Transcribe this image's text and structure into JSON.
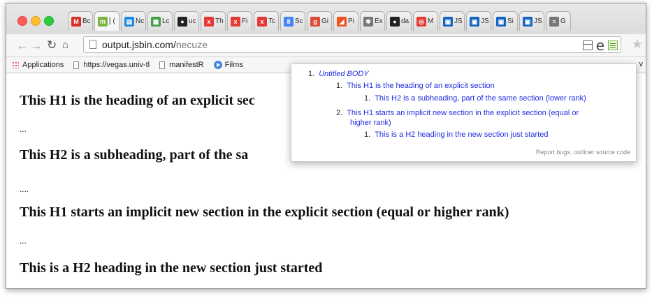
{
  "tabs": [
    {
      "label": "Bc",
      "icon": "gmail-icon",
      "color": "#d93025",
      "glyph": "M",
      "active": false
    },
    {
      "label": "[ (",
      "icon": "m-icon",
      "color": "#7cb342",
      "glyph": "m",
      "active": true
    },
    {
      "label": "Nc",
      "icon": "doc-icon",
      "color": "#1e88e5",
      "glyph": "▤",
      "active": false
    },
    {
      "label": "Lc",
      "icon": "sheet-icon",
      "color": "#43a047",
      "glyph": "▦",
      "active": false
    },
    {
      "label": "uc",
      "icon": "github-icon",
      "color": "#222222",
      "glyph": "●",
      "active": false
    },
    {
      "label": "Th",
      "icon": "xsl-icon",
      "color": "#e53935",
      "glyph": "x",
      "active": false
    },
    {
      "label": "Fi",
      "icon": "xsl-icon",
      "color": "#e53935",
      "glyph": "x",
      "active": false
    },
    {
      "label": "Tc",
      "icon": "xsl-icon",
      "color": "#e53935",
      "glyph": "x",
      "active": false
    },
    {
      "label": "Sc",
      "icon": "google-search-icon",
      "color": "#4285f4",
      "glyph": "8",
      "active": false
    },
    {
      "label": "Gi",
      "icon": "google-plus-icon",
      "color": "#dd4b39",
      "glyph": "g",
      "active": false
    },
    {
      "label": "Pi",
      "icon": "slope-icon",
      "color": "#f4511e",
      "glyph": "◢",
      "active": false
    },
    {
      "label": "Ex",
      "icon": "puzzle-icon",
      "color": "#777777",
      "glyph": "✱",
      "active": false
    },
    {
      "label": "da",
      "icon": "github-icon",
      "color": "#222222",
      "glyph": "●",
      "active": false
    },
    {
      "label": "M",
      "icon": "target-icon",
      "color": "#e53935",
      "glyph": "◎",
      "active": false
    },
    {
      "label": "JS",
      "icon": "js-icon",
      "color": "#1565c0",
      "glyph": "▣",
      "active": false
    },
    {
      "label": "JS",
      "icon": "js-icon",
      "color": "#1565c0",
      "glyph": "▣",
      "active": false
    },
    {
      "label": "Si",
      "icon": "js-icon",
      "color": "#1565c0",
      "glyph": "▣",
      "active": false
    },
    {
      "label": "JS",
      "icon": "js-icon",
      "color": "#1565c0",
      "glyph": "▣",
      "active": false
    },
    {
      "label": "G",
      "icon": "list-icon",
      "color": "#777777",
      "glyph": "≡",
      "active": false
    }
  ],
  "toolbar": {
    "url_host": "output.jsbin.com/",
    "url_path": "necuze"
  },
  "bookmarks": [
    {
      "label": "Applications",
      "icon": "apps-grid-icon"
    },
    {
      "label": "https://vegas.univ-tl",
      "icon": "page-icon"
    },
    {
      "label": "manifestR",
      "icon": "page-icon"
    },
    {
      "label": "Films",
      "icon": "play-circle-icon"
    }
  ],
  "bookmarks_trailing": "v",
  "content": {
    "h1_first": "This H1 is the heading of an explicit sec",
    "p1": "...",
    "h2_first": "This H2 is a subheading, part of the sa",
    "h2_first_trail": "(",
    "p2": "....",
    "h1_second": "This H1 starts an implicit new section in the explicit section (equal or higher rank)",
    "p3": "...",
    "h2_second": "This is a H2 heading in the new section just started"
  },
  "outline": {
    "items": [
      {
        "num": "1.",
        "text": "Untitled BODY"
      },
      {
        "num": "1.",
        "text": "This H1 is the heading of an explicit section"
      },
      {
        "num": "1.",
        "text": "This H2 is a subheading, part of the same section (lower rank)"
      },
      {
        "num": "2.",
        "text": "This H1 starts an implicit new section in the explicit section (equal or"
      },
      {
        "num": "",
        "text": "higher rank)"
      },
      {
        "num": "1.",
        "text": "This is a H2 heading in the new section just started"
      }
    ],
    "footer_link1": "Report bugs",
    "footer_sep": ", ",
    "footer_link2": "outliner source code"
  }
}
